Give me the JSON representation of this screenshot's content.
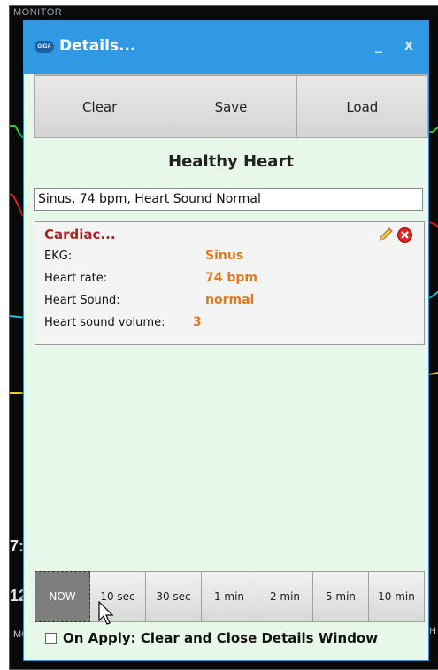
{
  "background": {
    "window_title": "MONITOR",
    "readouts": [
      "7:",
      "12"
    ],
    "footer_left": "MO",
    "footer_right": "H"
  },
  "dialog": {
    "title": "Details...",
    "minimize_label": "_",
    "close_label": "x",
    "toolbar": {
      "clear_label": "Clear",
      "save_label": "Save",
      "load_label": "Load"
    },
    "preset_name": "Healthy Heart",
    "description_value": "Sinus, 74 bpm, Heart Sound Normal",
    "section": {
      "title": "Cardiac...",
      "rows": [
        {
          "key": "EKG:",
          "value": "Sinus"
        },
        {
          "key": "Heart rate:",
          "value": "74 bpm"
        },
        {
          "key": "Heart Sound:",
          "value": "normal"
        },
        {
          "key": "Heart sound volume:",
          "value": "3"
        }
      ]
    },
    "time_buttons": [
      "NOW",
      "10 sec",
      "30 sec",
      "1 min",
      "2 min",
      "5 min",
      "10 min"
    ],
    "selected_time": "NOW",
    "apply_option": {
      "label": "On Apply: Clear and Close Details Window",
      "checked": false
    }
  },
  "colors": {
    "titlebar": "#2f99e3",
    "dialog_bg": "#e8f8e8",
    "section_title": "#b22222",
    "value": "#e07a1f",
    "active_time": "#7e7e7e"
  },
  "icons": [
    "logo-icon",
    "pencil-icon",
    "delete-icon",
    "pointer-cursor-icon"
  ]
}
